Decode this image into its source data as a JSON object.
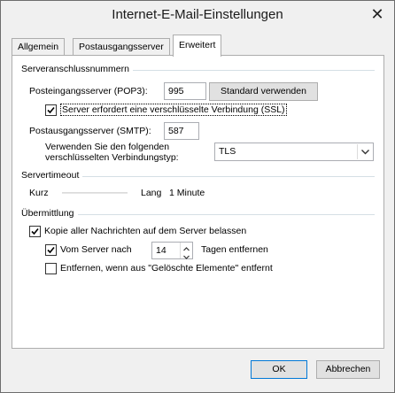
{
  "window": {
    "title": "Internet-E-Mail-Einstellungen",
    "close_glyph": "✕"
  },
  "tabs": [
    {
      "label": "Allgemein"
    },
    {
      "label": "Postausgangsserver"
    },
    {
      "label": "Erweitert",
      "active": true
    }
  ],
  "server_ports": {
    "section_label": "Serveranschlussnummern",
    "incoming_label": "Posteingangsserver (POP3):",
    "incoming_value": "995",
    "default_button": "Standard verwenden",
    "ssl_label": "Server erfordert eine verschlüsselte Verbindung (SSL)",
    "ssl_checked": true,
    "outgoing_label": "Postausgangsserver (SMTP):",
    "outgoing_value": "587",
    "encryption_label_line1": "Verwenden Sie den folgenden",
    "encryption_label_line2": "verschlüsselten Verbindungstyp:",
    "encryption_value": "TLS"
  },
  "timeout": {
    "section_label": "Servertimeout",
    "short_label": "Kurz",
    "long_label": "Lang",
    "value_text": "1 Minute"
  },
  "delivery": {
    "section_label": "Übermittlung",
    "keep_copy_label": "Kopie aller Nachrichten auf dem Server belassen",
    "keep_copy_checked": true,
    "remove_after_label": "Vom Server nach",
    "remove_after_checked": true,
    "remove_after_days": "14",
    "days_suffix": "Tagen entfernen",
    "remove_deleted_label": "Entfernen, wenn aus \"Gelöschte Elemente\" entfernt",
    "remove_deleted_checked": false
  },
  "footer": {
    "ok_label": "OK",
    "cancel_label": "Abbrechen"
  }
}
